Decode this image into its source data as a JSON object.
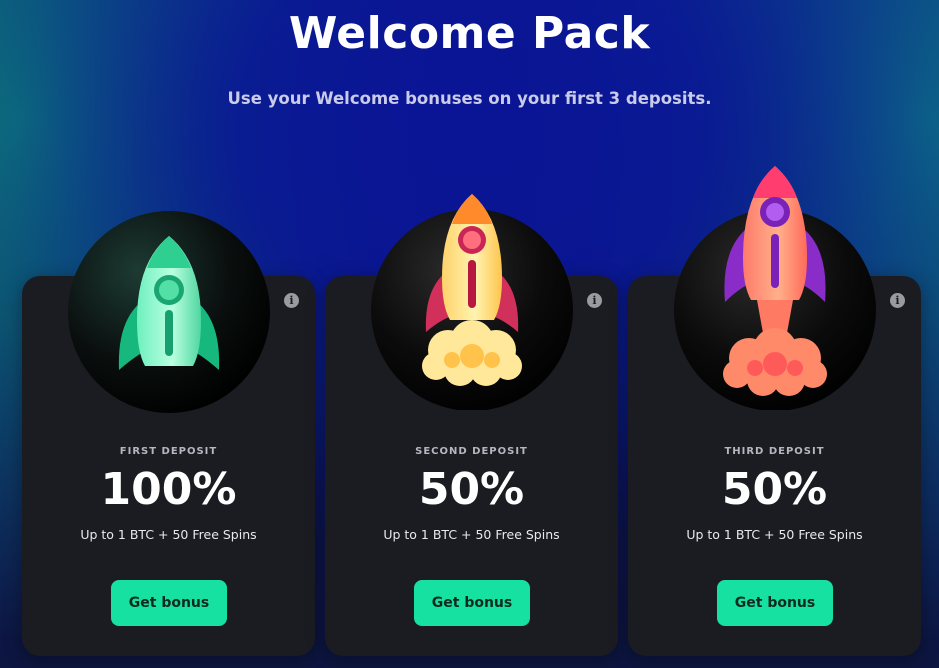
{
  "header": {
    "title": "Welcome Pack",
    "subtitle": "Use your Welcome bonuses on your first 3 deposits."
  },
  "cards": [
    {
      "label": "FIRST DEPOSIT",
      "percent": "100%",
      "description": "Up to 1 BTC + 50 Free Spins",
      "button": "Get bonus",
      "info": "i",
      "icon": "green-rocket-icon"
    },
    {
      "label": "SECOND DEPOSIT",
      "percent": "50%",
      "description": "Up to 1 BTC + 50 Free Spins",
      "button": "Get bonus",
      "info": "i",
      "icon": "yellow-rocket-launch-icon"
    },
    {
      "label": "THIRD DEPOSIT",
      "percent": "50%",
      "description": "Up to 1 BTC + 50 Free Spins",
      "button": "Get bonus",
      "info": "i",
      "icon": "orange-rocket-launch-icon"
    }
  ],
  "colors": {
    "accent": "#16e1a0",
    "card": "#1b1c22",
    "background": "#0b1a86"
  }
}
